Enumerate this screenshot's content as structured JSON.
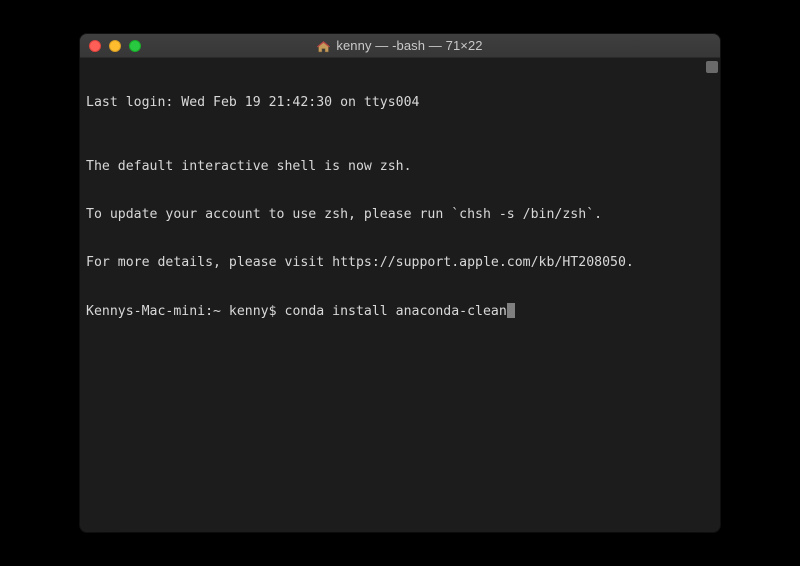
{
  "window": {
    "title": "kenny — -bash — 71×22"
  },
  "terminal": {
    "lines": {
      "l0": "Last login: Wed Feb 19 21:42:30 on ttys004",
      "l1": "",
      "l2": "The default interactive shell is now zsh.",
      "l3": "To update your account to use zsh, please run `chsh -s /bin/zsh`.",
      "l4": "For more details, please visit https://support.apple.com/kb/HT208050.",
      "prompt": "Kennys-Mac-mini:~ kenny$ ",
      "command": "conda install anaconda-clean"
    }
  },
  "colors": {
    "bg": "#1c1c1c",
    "text": "#d8d8d8"
  }
}
